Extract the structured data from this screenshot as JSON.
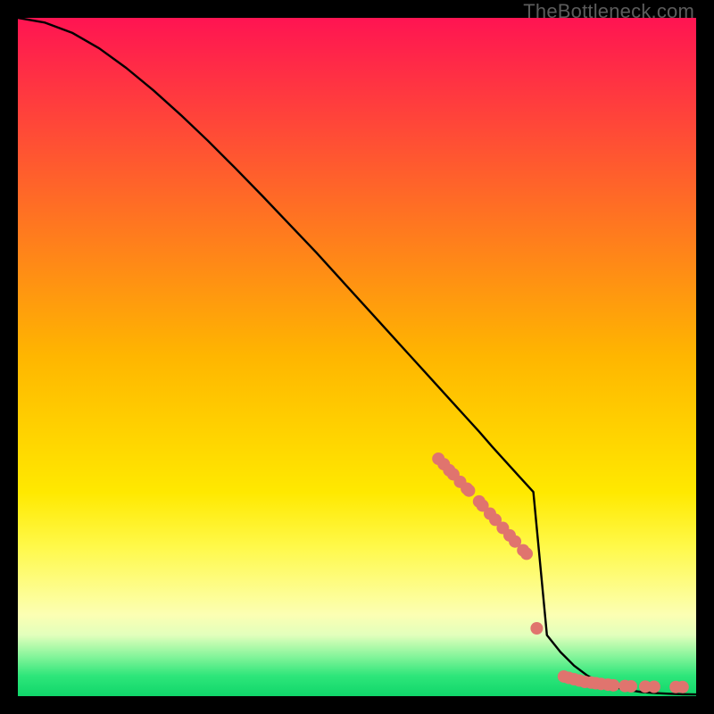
{
  "watermark": "TheBottleneck.com",
  "chart_data": {
    "type": "line",
    "title": "",
    "xlabel": "",
    "ylabel": "",
    "xlim": [
      0,
      100
    ],
    "ylim": [
      0,
      100
    ],
    "series": [
      {
        "name": "curve",
        "x": [
          0,
          4,
          8,
          12,
          16,
          20,
          24,
          28,
          32,
          36,
          40,
          44,
          48,
          52,
          56,
          58,
          60,
          62,
          64,
          66,
          68,
          70,
          72,
          74,
          76,
          78,
          80,
          82,
          84,
          86,
          88,
          90,
          92,
          94,
          96,
          98,
          100
        ],
        "y": [
          100,
          99.3,
          97.8,
          95.5,
          92.6,
          89.3,
          85.7,
          81.9,
          77.9,
          73.8,
          69.6,
          65.4,
          61.0,
          56.6,
          52.2,
          50.0,
          47.8,
          45.6,
          43.4,
          41.2,
          39.0,
          36.7,
          34.5,
          32.3,
          30.1,
          9.0,
          6.5,
          4.5,
          3.0,
          2.0,
          1.3,
          0.9,
          0.6,
          0.45,
          0.35,
          0.28,
          0.25
        ]
      }
    ],
    "markers": {
      "name": "highlight-points",
      "color": "#e0746e",
      "x": [
        62.0,
        62.8,
        63.6,
        64.2,
        65.2,
        66.2,
        66.5,
        68.0,
        68.5,
        69.6,
        70.4,
        71.5,
        72.5,
        73.3,
        74.5,
        75.0,
        76.5,
        80.5,
        81.2,
        82.0,
        82.8,
        83.6,
        84.5,
        85.2,
        86.0,
        87.0,
        87.8,
        89.5,
        90.4,
        92.5,
        93.8,
        97.0,
        98.0
      ],
      "y": [
        35.0,
        34.2,
        33.3,
        32.7,
        31.6,
        30.6,
        30.3,
        28.7,
        28.1,
        26.9,
        26.0,
        24.8,
        23.7,
        22.8,
        21.5,
        21.0,
        10.0,
        2.9,
        2.7,
        2.5,
        2.3,
        2.1,
        2.0,
        1.9,
        1.8,
        1.7,
        1.6,
        1.5,
        1.45,
        1.4,
        1.38,
        1.35,
        1.35
      ]
    },
    "gradient_bands": [
      {
        "y": 100,
        "color": "#ff1452"
      },
      {
        "y": 50,
        "color": "#ffb600"
      },
      {
        "y": 30,
        "color": "#ffe900"
      },
      {
        "y": 22,
        "color": "#fff94a"
      },
      {
        "y": 12,
        "color": "#fcffb3"
      },
      {
        "y": 9,
        "color": "#e2ffbc"
      },
      {
        "y": 6,
        "color": "#89f59c"
      },
      {
        "y": 3,
        "color": "#2ee67a"
      },
      {
        "y": 0,
        "color": "#10d66a"
      }
    ]
  }
}
